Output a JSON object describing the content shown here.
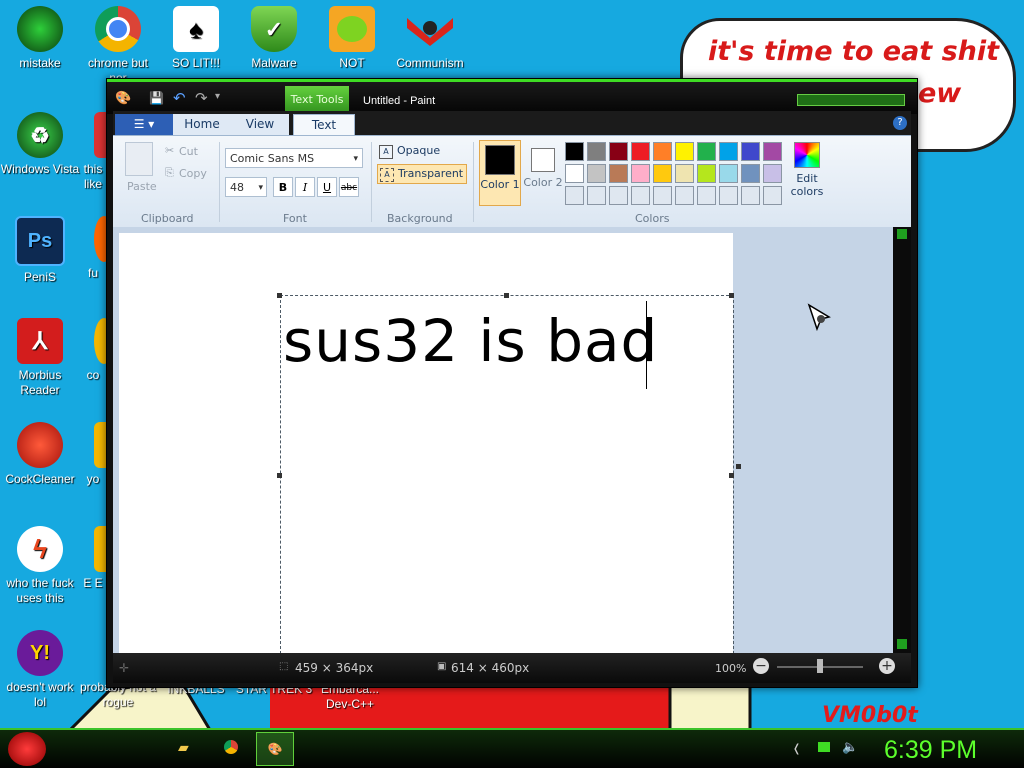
{
  "desktop": {
    "bubble_line1": "it's time to eat shit",
    "bubble_line2": "ew",
    "signature": "VM0b0t",
    "icons": [
      {
        "label": "mistake",
        "icon": "green-orb-icon"
      },
      {
        "label": "chrome but nor",
        "icon": "chrome-icon"
      },
      {
        "label": "SO LIT!!!",
        "icon": "cards-icon"
      },
      {
        "label": "Malware",
        "icon": "shield-icon"
      },
      {
        "label": "NOT",
        "icon": "pig-icon"
      },
      {
        "label": "Communism",
        "icon": "flag-icon"
      },
      {
        "label": "Windows Vista",
        "icon": "recycle-icon"
      },
      {
        "label": "this like",
        "icon": "app-icon"
      },
      {
        "label": "PeniS",
        "icon": "photoshop-icon"
      },
      {
        "label": "fu",
        "icon": "firefox-icon"
      },
      {
        "label": "Morbius Reader",
        "icon": "pdf-icon"
      },
      {
        "label": "co",
        "icon": "app-icon"
      },
      {
        "label": "CockCleaner",
        "icon": "ccleaner-icon"
      },
      {
        "label": "yo",
        "icon": "app-icon"
      },
      {
        "label": "who the fuck uses this",
        "icon": "flash-icon"
      },
      {
        "label": "E E",
        "icon": "app-icon"
      },
      {
        "label": "doesn't work lol",
        "icon": "yahoo-icon"
      },
      {
        "label": "probably not a rogue",
        "icon": "app-icon"
      },
      {
        "label": "INKBALLS",
        "icon": "app-icon"
      },
      {
        "label": "STAR TREK 3",
        "icon": "app-icon"
      },
      {
        "label": "Embarca... Dev-C++",
        "icon": "app-icon"
      }
    ]
  },
  "window": {
    "title": "Untitled - Paint",
    "context_tab": "Text Tools",
    "tabs": [
      "Home",
      "View",
      "Text"
    ],
    "clipboard": {
      "paste": "Paste",
      "cut": "Cut",
      "copy": "Copy",
      "group": "Clipboard"
    },
    "font": {
      "family": "Comic Sans MS",
      "size": "48",
      "group": "Font",
      "bold": "B",
      "italic": "I",
      "underline": "U",
      "strike": "abc"
    },
    "background": {
      "opaque": "Opaque",
      "transparent": "Transparent",
      "group": "Background"
    },
    "colors": {
      "color1": "Color 1",
      "color2": "Color 2",
      "edit": "Edit colors",
      "group": "Colors"
    },
    "canvas_text": "sus32 is bad",
    "status": {
      "selection": "459 × 364px",
      "image_size": "614 × 460px",
      "zoom": "100%"
    }
  },
  "palette_row1": [
    "#000000",
    "#7f7f7f",
    "#880015",
    "#ed1c24",
    "#ff7f27",
    "#fff200",
    "#22b14c",
    "#00a2e8",
    "#3f48cc",
    "#a349a4"
  ],
  "palette_row2": [
    "#ffffff",
    "#c3c3c3",
    "#b97a57",
    "#ffaec9",
    "#ffc90e",
    "#efe4b0",
    "#b5e61d",
    "#99d9ea",
    "#7092be",
    "#c8bfe7"
  ],
  "taskbar": {
    "clock": "6:39 PM"
  }
}
